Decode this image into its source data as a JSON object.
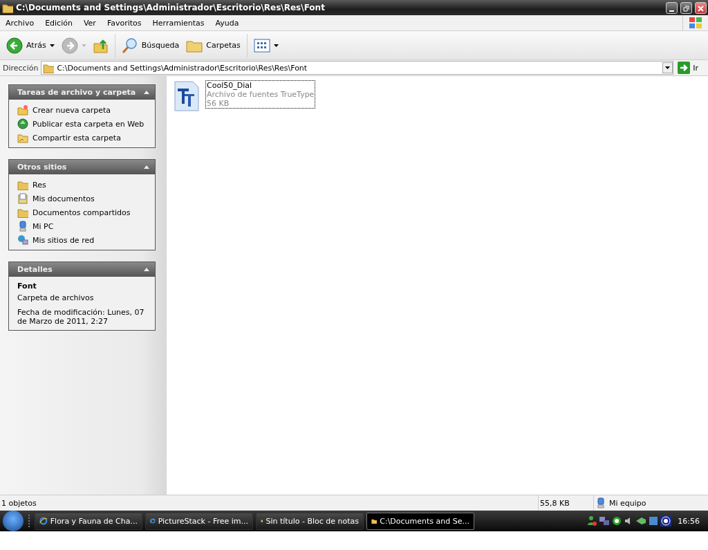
{
  "window": {
    "title": "C:\\Documents and Settings\\Administrador\\Escritorio\\Res\\Res\\Font"
  },
  "menu": [
    "Archivo",
    "Edición",
    "Ver",
    "Favoritos",
    "Herramientas",
    "Ayuda"
  ],
  "toolbar": [
    {
      "kind": "back",
      "label": "Atrás",
      "disabled": false
    },
    {
      "kind": "forward",
      "disabled": true
    },
    {
      "kind": "up"
    },
    {
      "kind": "search",
      "label": "Búsqueda"
    },
    {
      "kind": "folders",
      "label": "Carpetas"
    },
    {
      "kind": "views"
    }
  ],
  "address": {
    "label": "Dirección",
    "value": "C:\\Documents and Settings\\Administrador\\Escritorio\\Res\\Res\\Font",
    "go": "Ir"
  },
  "panels": [
    {
      "title": "Tareas de archivo y carpeta",
      "expanded": true,
      "items": [
        {
          "kind": "newfolder",
          "label": "Crear nueva carpeta"
        },
        {
          "kind": "web",
          "label": "Publicar esta carpeta en Web"
        },
        {
          "kind": "share",
          "label": "Compartir esta carpeta"
        }
      ]
    },
    {
      "title": "Otros sitios",
      "expanded": true,
      "items": [
        {
          "kind": "folder",
          "label": "Res"
        },
        {
          "kind": "docs",
          "label": "Mis documentos"
        },
        {
          "kind": "folder",
          "label": "Documentos compartidos"
        },
        {
          "kind": "pc",
          "label": "Mi PC"
        },
        {
          "kind": "network",
          "label": "Mis sitios de red"
        }
      ]
    },
    {
      "title": "Detalles",
      "expanded": true,
      "details": {
        "name": "Font",
        "type": "Carpeta de archivos",
        "modified": "Fecha de modificación: Lunes, 07 de Marzo de 2011, 2:27"
      }
    }
  ],
  "files": [
    {
      "name": "Cool50_Dial",
      "type": "Archivo de fuentes TrueType",
      "size": "56 KB",
      "selected": true
    }
  ],
  "status_bar": {
    "count": "1 objetos",
    "size": "55,8 KB",
    "zone": "Mi equipo"
  },
  "taskbar": {
    "items": [
      {
        "kind": "browser",
        "label": "Flora y Fauna de Cha...",
        "selected": false
      },
      {
        "kind": "browser",
        "label": "PictureStack - Free im...",
        "selected": false
      },
      {
        "kind": "notepad",
        "label": "Sin título - Bloc de notas",
        "selected": false
      },
      {
        "kind": "folder",
        "label": "C:\\Documents and Se...",
        "selected": true
      }
    ],
    "clock": "16:56"
  }
}
